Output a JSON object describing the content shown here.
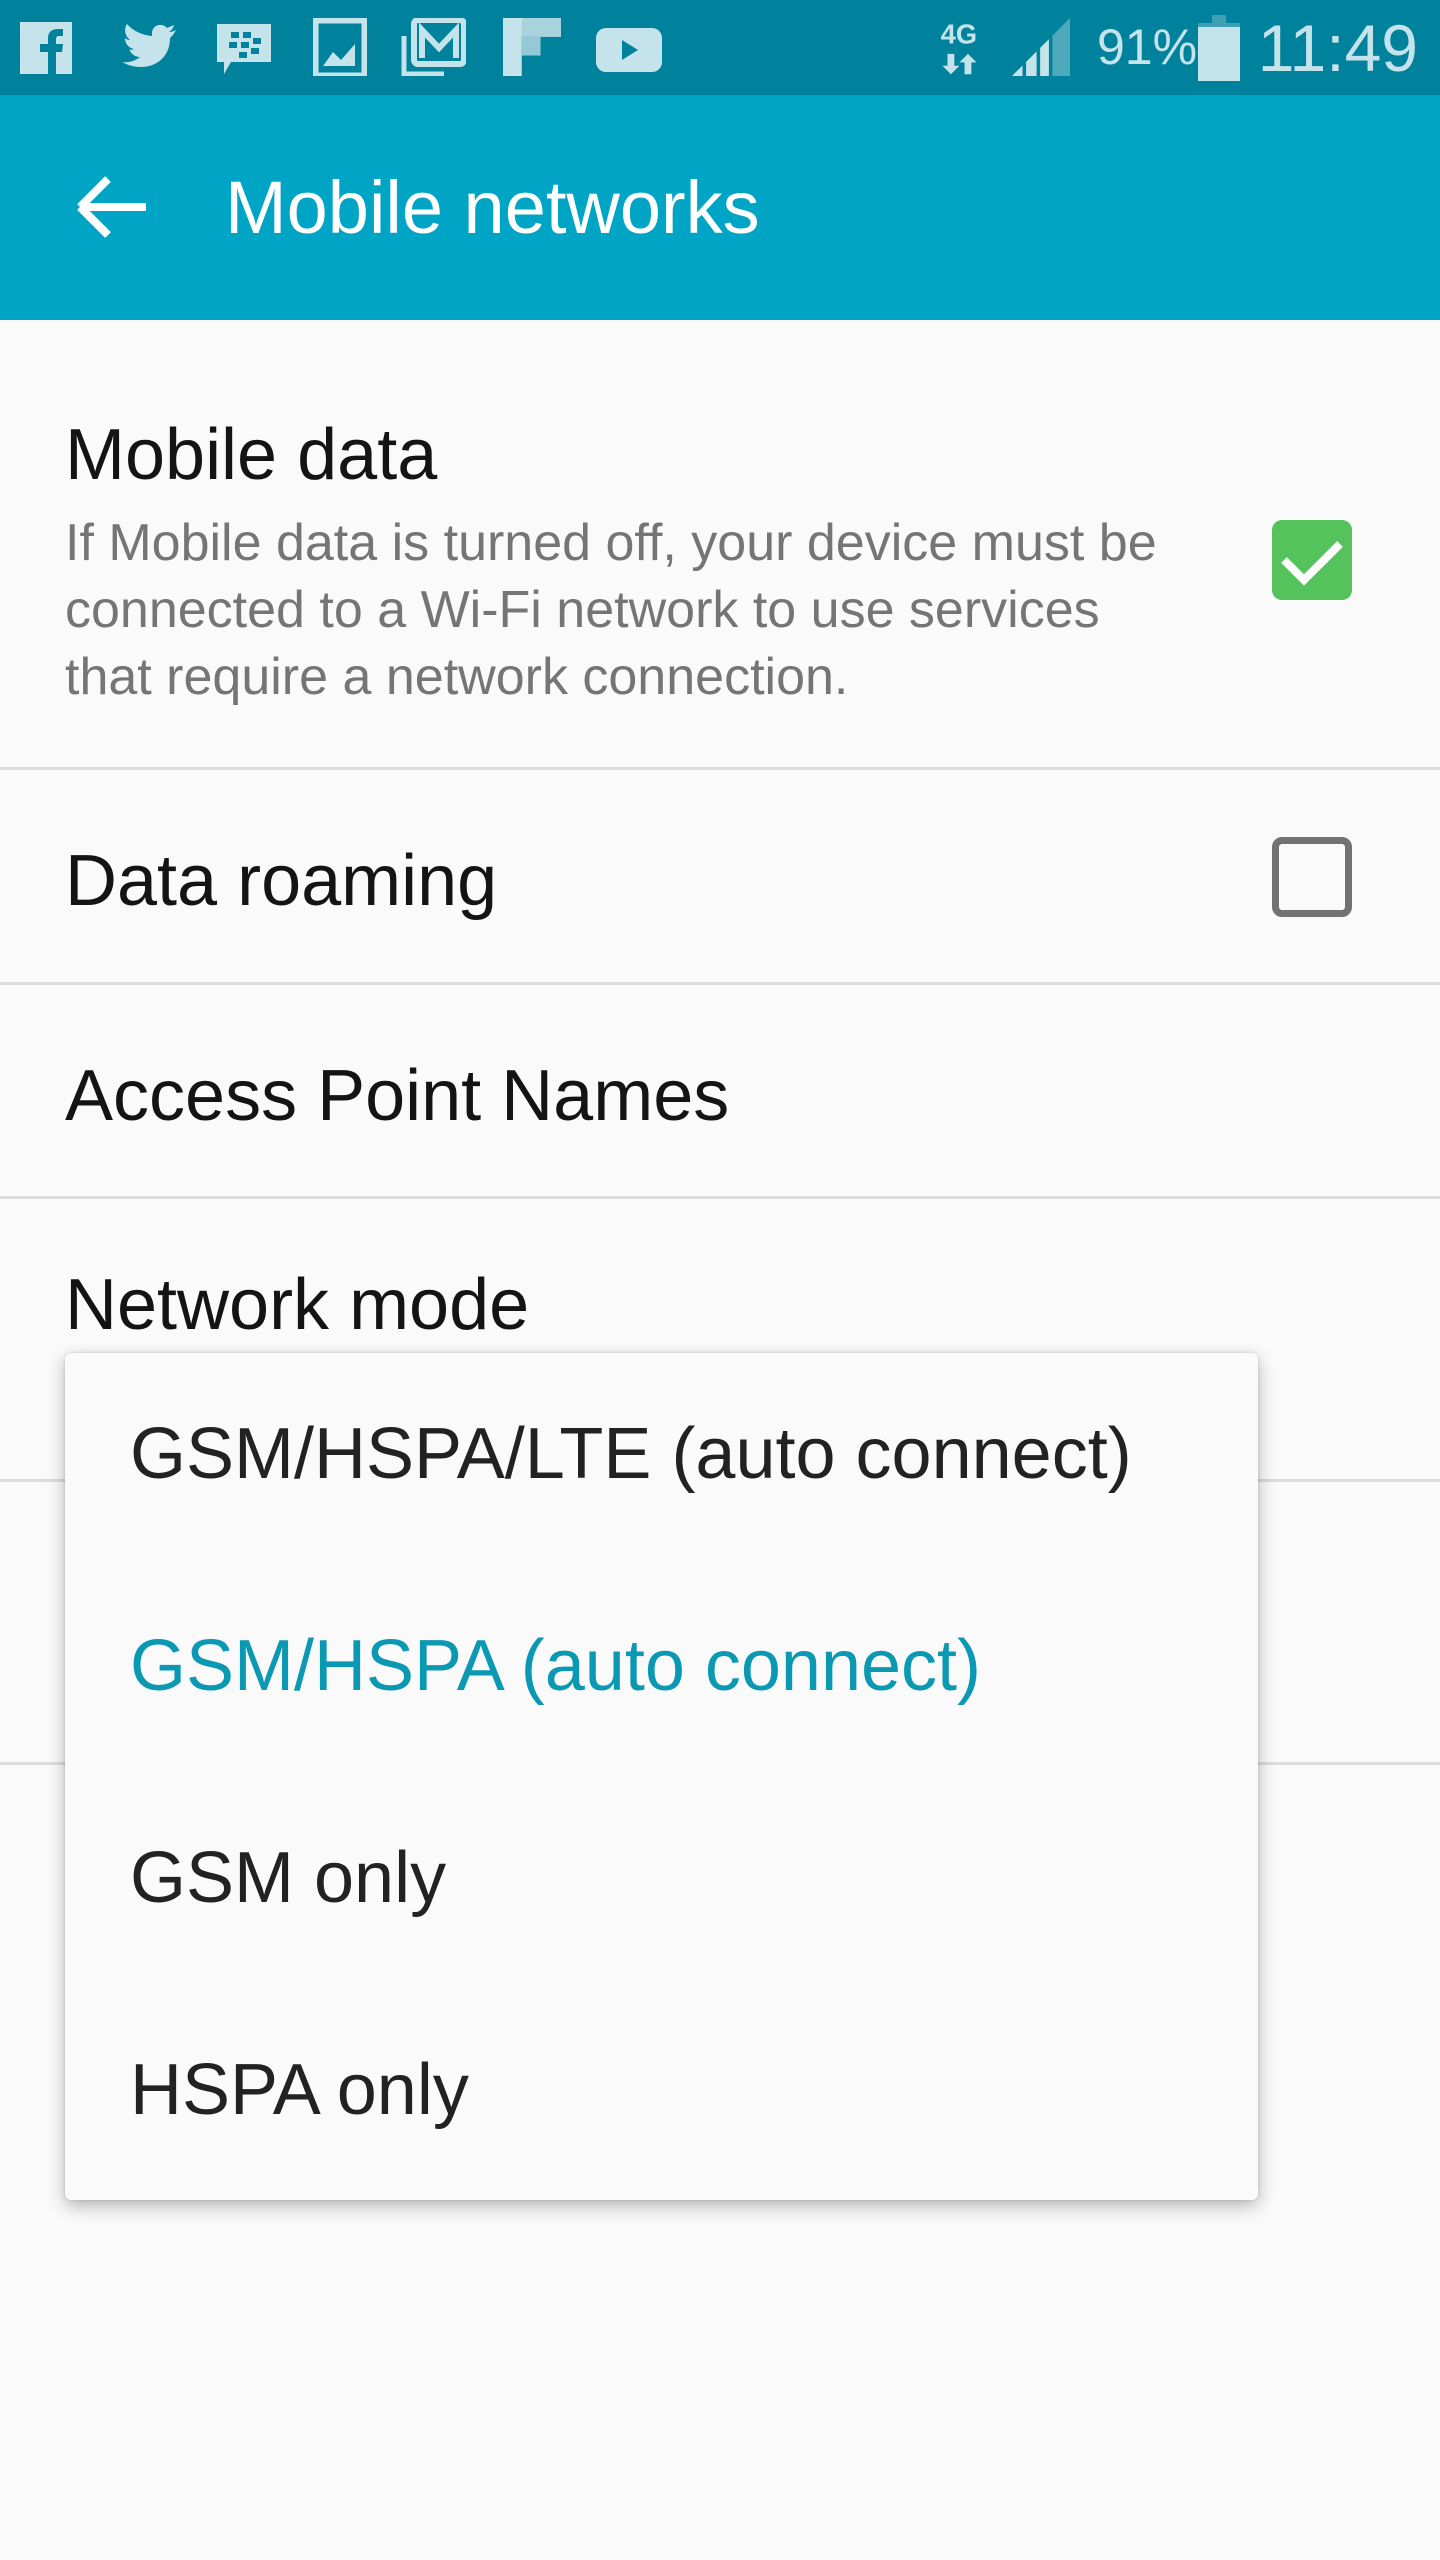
{
  "status_bar": {
    "notification_icons": [
      "facebook-icon",
      "twitter-icon",
      "bbm-icon",
      "gallery-icon",
      "email-icon",
      "flipboard-icon",
      "youtube-icon"
    ],
    "network_type": "4G",
    "battery_percent": "91%",
    "time": "11:49"
  },
  "app_bar": {
    "title": "Mobile networks",
    "back_icon": "arrow-left-icon"
  },
  "settings": [
    {
      "title": "Mobile data",
      "summary": "If Mobile data is turned off, your device must be connected to a Wi-Fi network to use services that require a network connection.",
      "checked": true
    },
    {
      "title": "Data roaming",
      "checked": false
    },
    {
      "title": "Access Point Names"
    },
    {
      "title": "Network mode"
    }
  ],
  "network_mode_menu": {
    "options": [
      "GSM/HSPA/LTE (auto connect)",
      "GSM/HSPA (auto connect)",
      "GSM only",
      "HSPA only"
    ],
    "selected": "GSM/HSPA (auto connect)"
  },
  "colors": {
    "status_bar": "#00829c",
    "app_bar": "#00a5c6",
    "checkbox_on": "#55c35c",
    "selected_option": "#0a98b3"
  }
}
